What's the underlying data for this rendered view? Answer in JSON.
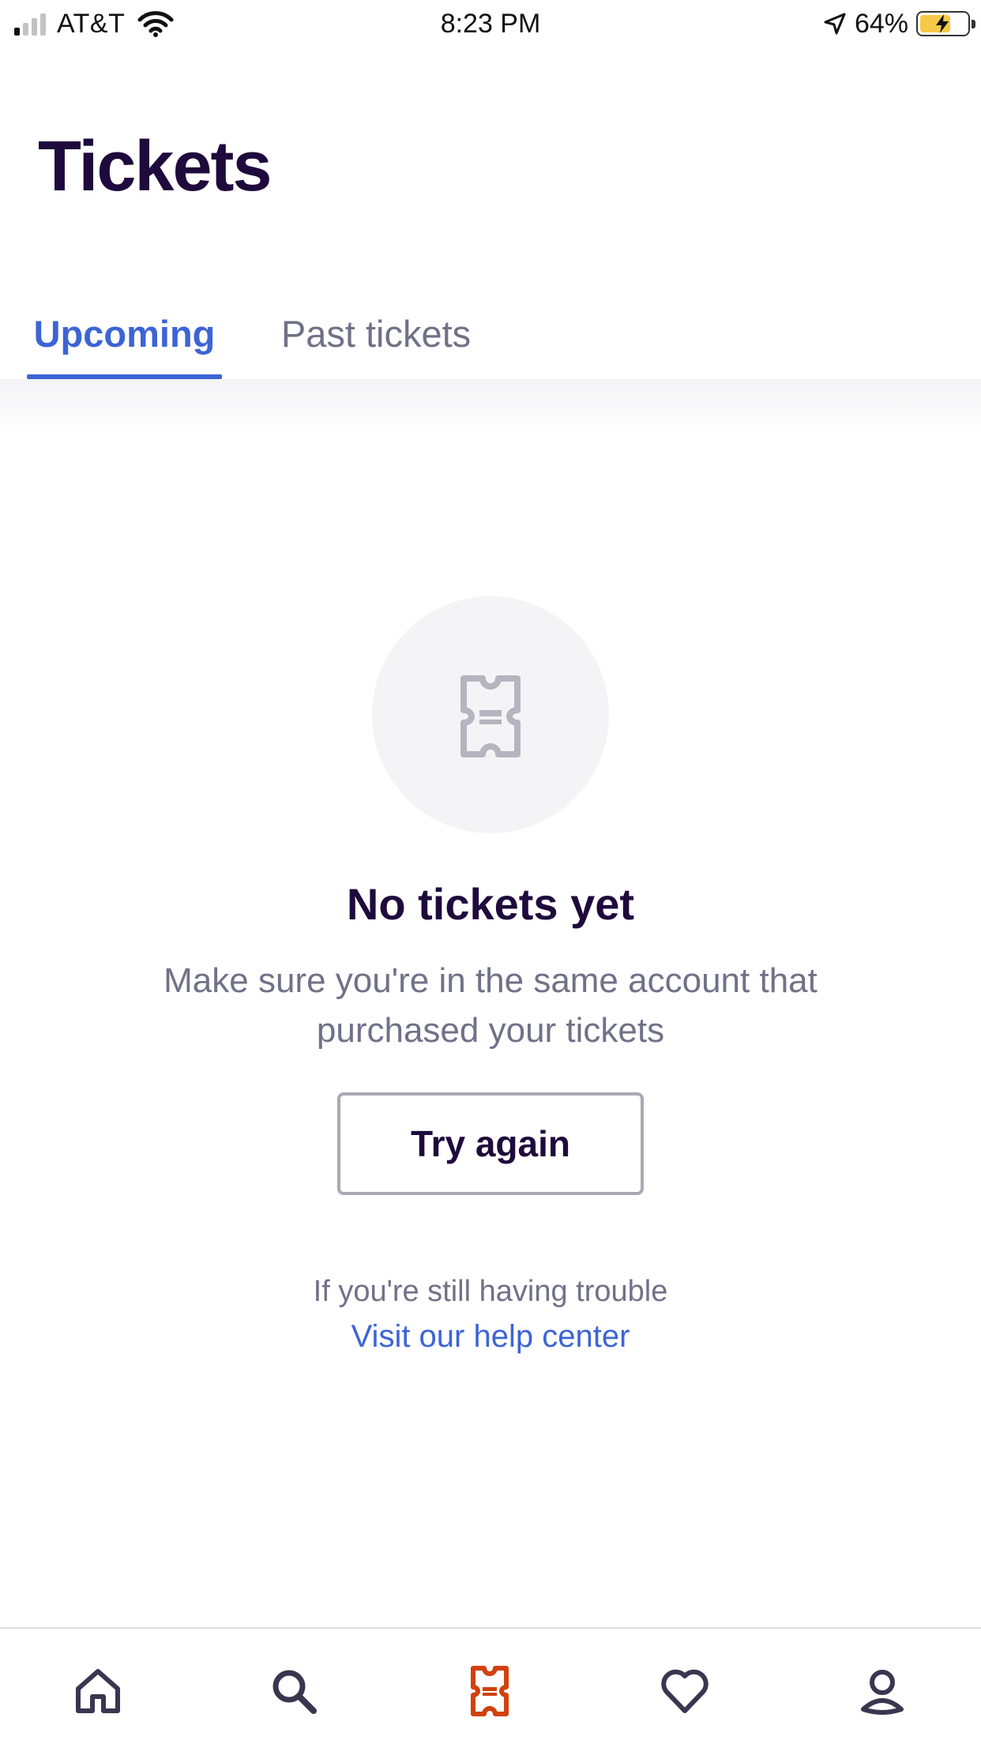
{
  "status_bar": {
    "carrier": "AT&T",
    "time": "8:23 PM",
    "battery_percent": "64%",
    "signal_bars": 1,
    "icons": [
      "signal-icon",
      "wifi-icon",
      "location-arrow-icon",
      "battery-charging-icon"
    ]
  },
  "header": {
    "title": "Tickets"
  },
  "tabs": [
    {
      "label": "Upcoming",
      "active": true
    },
    {
      "label": "Past tickets",
      "active": false
    }
  ],
  "empty_state": {
    "icon": "ticket-icon",
    "title": "No tickets yet",
    "description": "Make sure you're in the same account that purchased your tickets",
    "button_label": "Try again",
    "trouble_text": "If you're still having trouble",
    "help_link": "Visit our help center"
  },
  "bottom_nav": {
    "items": [
      {
        "icon": "home-icon",
        "active": false
      },
      {
        "icon": "search-icon",
        "active": false
      },
      {
        "icon": "ticket-icon",
        "active": true
      },
      {
        "icon": "heart-icon",
        "active": false
      },
      {
        "icon": "profile-icon",
        "active": false
      }
    ]
  },
  "colors": {
    "brand_dark": "#1e0a3c",
    "accent_blue": "#3d64d6",
    "muted_text": "#6f7287",
    "active_nav": "#d1410c",
    "inactive_nav": "#39364f"
  }
}
